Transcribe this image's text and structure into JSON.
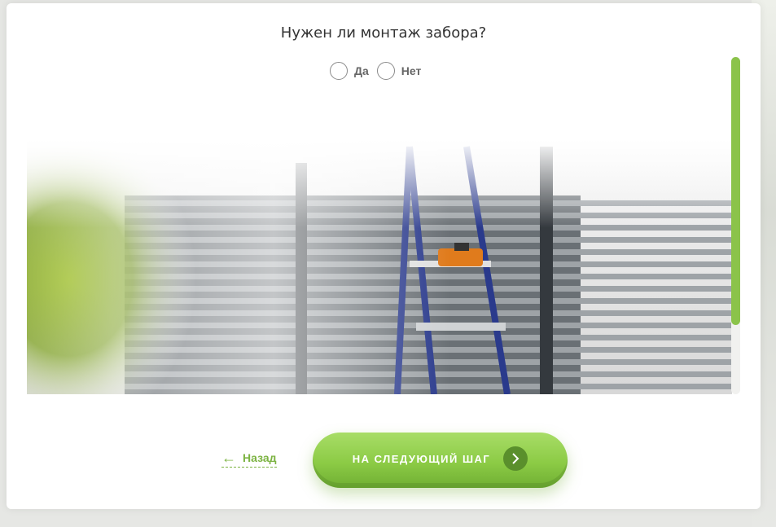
{
  "question": {
    "title": "Нужен ли монтаж забора?"
  },
  "options": [
    {
      "label": "Да",
      "selected": false
    },
    {
      "label": "Нет",
      "selected": false
    }
  ],
  "scrollbar": {
    "color": "#8bc34a"
  },
  "navigation": {
    "back_label": "Назад",
    "next_label": "НА СЛЕДУЮЩИЙ ШАГ",
    "accent_color": "#7cb342"
  },
  "icons": {
    "back": "arrow-left-icon",
    "next": "chevron-right-icon"
  }
}
